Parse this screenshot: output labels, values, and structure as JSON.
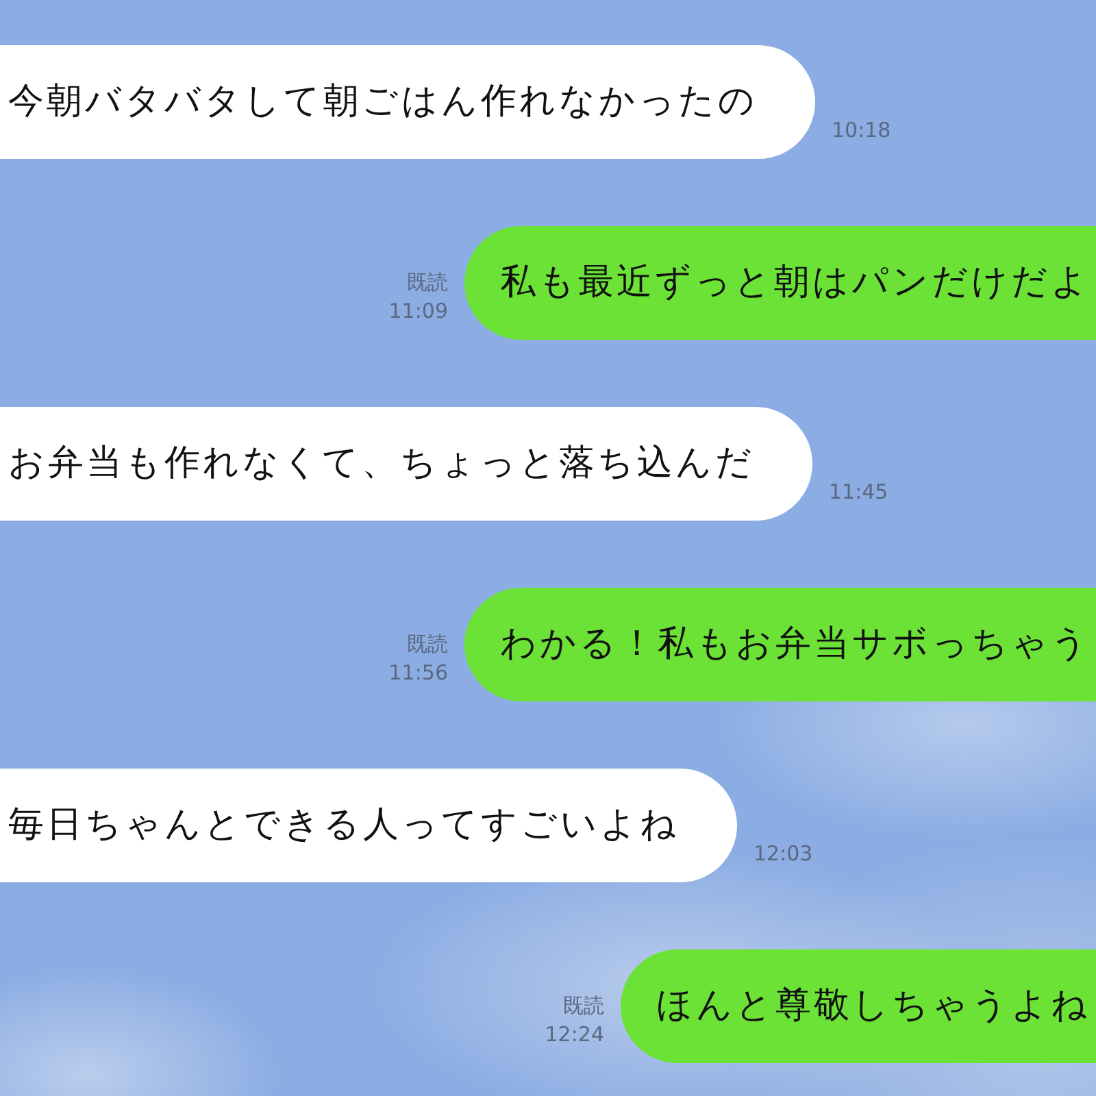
{
  "messages": [
    {
      "kind": "received",
      "text": "今朝バタバタして朝ごはん作れなかったの",
      "time": "10:18"
    },
    {
      "kind": "sent",
      "text": "私も最近ずっと朝はパンだけだよ",
      "read_label": "既読",
      "time": "11:09"
    },
    {
      "kind": "received",
      "text": "お弁当も作れなくて、ちょっと落ち込んだ",
      "time": "11:45"
    },
    {
      "kind": "sent",
      "text": "わかる！私もお弁当サボっちゃう",
      "read_label": "既読",
      "time": "11:56"
    },
    {
      "kind": "received",
      "text": "毎日ちゃんとできる人ってすごいよね",
      "time": "12:03"
    },
    {
      "kind": "sent",
      "text": "ほんと尊敬しちゃうよね",
      "read_label": "既読",
      "time": "12:24"
    }
  ]
}
